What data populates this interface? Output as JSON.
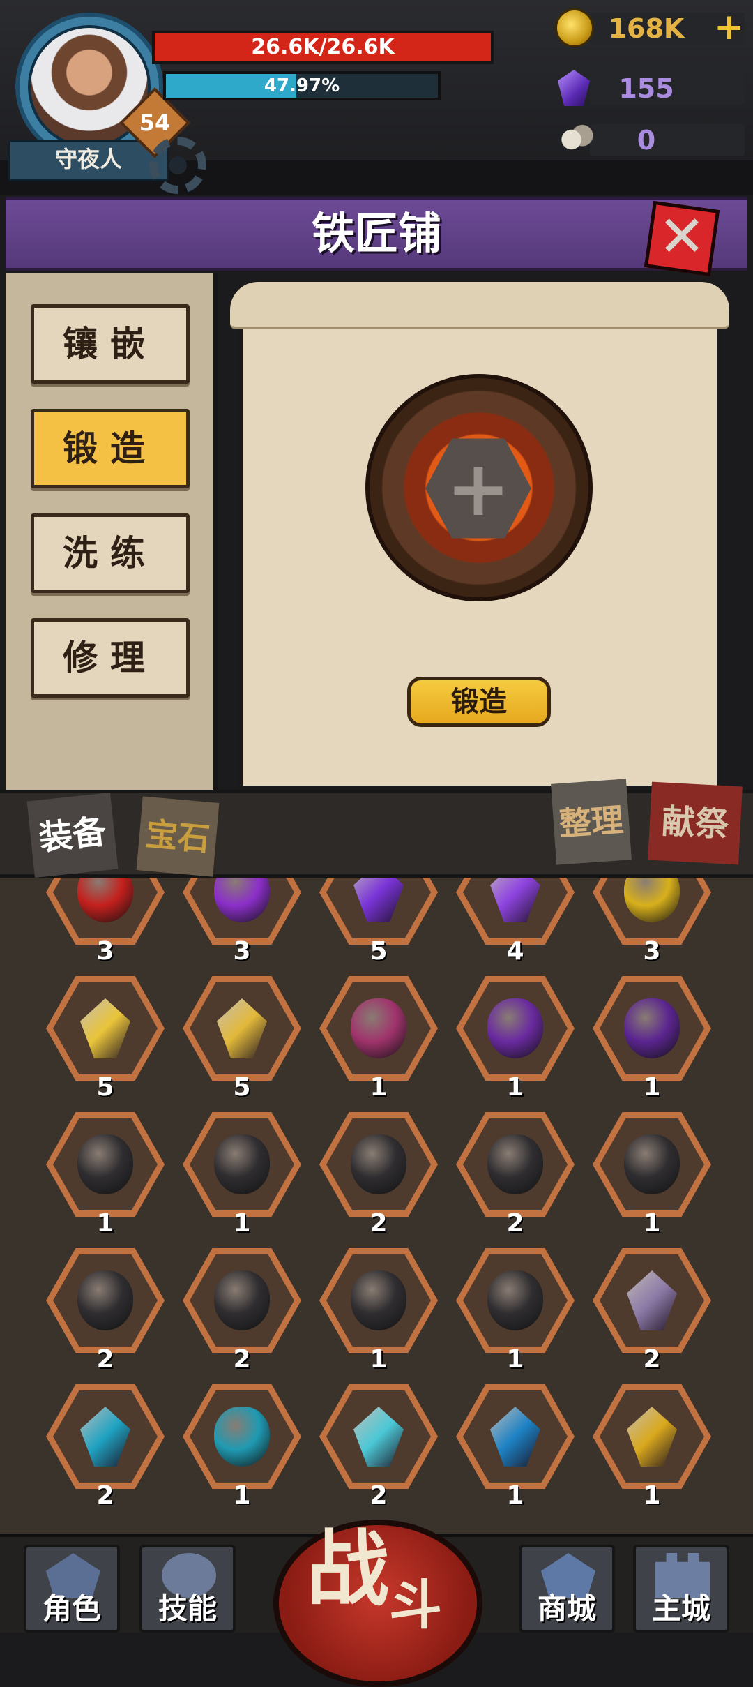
{
  "player": {
    "name": "守夜人",
    "level": "54",
    "hp_text": "26.6K/26.6K",
    "xp_text": "47.97%",
    "xp_fraction": 0.4797
  },
  "resources": {
    "gold": "168K",
    "gems": "155",
    "skulls": "0",
    "add_symbol": "+"
  },
  "page": {
    "title": "铁匠铺",
    "close_symbol": "✕"
  },
  "side_tabs": [
    {
      "label": "镶嵌",
      "active": false
    },
    {
      "label": "锻造",
      "active": true
    },
    {
      "label": "洗练",
      "active": false
    },
    {
      "label": "修理",
      "active": false
    }
  ],
  "forge": {
    "slot_symbol": "+",
    "button_label": "锻造"
  },
  "inventory_tabs": {
    "equipment": "装备",
    "gems": "宝石",
    "sort": "整理",
    "offering": "献祭"
  },
  "items": [
    {
      "icon": "red-orb-icon",
      "count": "3",
      "color": "#c4201d"
    },
    {
      "icon": "purple-orb-icon",
      "count": "3",
      "color": "#8b2fc9"
    },
    {
      "icon": "purple-crystal-icon",
      "count": "5",
      "color": "#7a34d8"
    },
    {
      "icon": "purple-shard-icon",
      "count": "4",
      "color": "#8e44e0"
    },
    {
      "icon": "gold-orb-icon",
      "count": "3",
      "color": "#d8b01c"
    },
    {
      "icon": "gold-crystal-icon",
      "count": "5",
      "color": "#e9c43a"
    },
    {
      "icon": "gold-shard-icon",
      "count": "5",
      "color": "#e2b93a"
    },
    {
      "icon": "magenta-rune-stone-icon",
      "count": "1",
      "color": "#a0336c"
    },
    {
      "icon": "purple-swirl-rune-icon",
      "count": "1",
      "color": "#6a2aa0"
    },
    {
      "icon": "purple-glyph-rune-icon",
      "count": "1",
      "color": "#5b2590"
    },
    {
      "icon": "black-rune-stone-icon",
      "count": "1",
      "color": "#2f2d30"
    },
    {
      "icon": "black-rune-stone-icon",
      "count": "1",
      "color": "#2f2d30"
    },
    {
      "icon": "black-fishbone-rune-icon",
      "count": "2",
      "color": "#2f2d30"
    },
    {
      "icon": "black-spiral-rune-icon",
      "count": "2",
      "color": "#2f2d30"
    },
    {
      "icon": "black-eye-rune-icon",
      "count": "1",
      "color": "#2f2d30"
    },
    {
      "icon": "black-glyph-rune-icon",
      "count": "2",
      "color": "#2f2d30"
    },
    {
      "icon": "black-glyph-rune-icon",
      "count": "2",
      "color": "#2f2d30"
    },
    {
      "icon": "black-glyph-rune-icon",
      "count": "1",
      "color": "#2f2d30"
    },
    {
      "icon": "black-wave-rune-icon",
      "count": "1",
      "color": "#2f2d30"
    },
    {
      "icon": "prismatic-gem-icon",
      "count": "2",
      "color": "#8c7aa6"
    },
    {
      "icon": "cyan-crystal-icon",
      "count": "2",
      "color": "#1fa3c2"
    },
    {
      "icon": "cyan-orb-icon",
      "count": "1",
      "color": "#1f9ab2"
    },
    {
      "icon": "cyan-shard-icon",
      "count": "2",
      "color": "#4cc8d6"
    },
    {
      "icon": "blue-drop-gem-icon",
      "count": "1",
      "color": "#1d82c4"
    },
    {
      "icon": "gold-drop-gem-icon",
      "count": "1",
      "color": "#d9a81c"
    }
  ],
  "nav": {
    "character": "角色",
    "skills": "技能",
    "battle_a": "战",
    "battle_b": "斗",
    "shop": "商城",
    "city": "主城"
  }
}
